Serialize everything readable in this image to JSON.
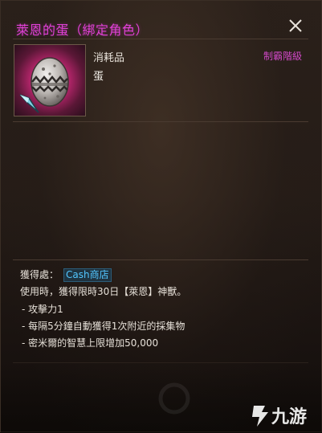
{
  "tooltip": {
    "title": "萊恩的蛋（綁定角色）",
    "title_color": "#e040d6",
    "close_icon": "close-icon",
    "category": "消耗品",
    "rank": "制霸階級",
    "rank_color": "#d048c6",
    "item_name": "蛋",
    "item_icon": "egg-icon",
    "item_icon_background": "#e83a8e",
    "corner_icon": "crystal-shard-icon"
  },
  "details": {
    "source_label": "獲得處：",
    "source_link": "Cash商店",
    "source_link_color": "#52c6ff",
    "description": "使用時，獲得限時30日【萊恩】神獸。",
    "bullets": [
      "- 攻擊力1",
      "- 每隔5分鐘自動獲得1次附近的採集物",
      "- 密米爾的智慧上限增加50,000"
    ]
  },
  "watermark": {
    "text": "九游",
    "logo_icon": "jiuyou-logo-icon"
  }
}
